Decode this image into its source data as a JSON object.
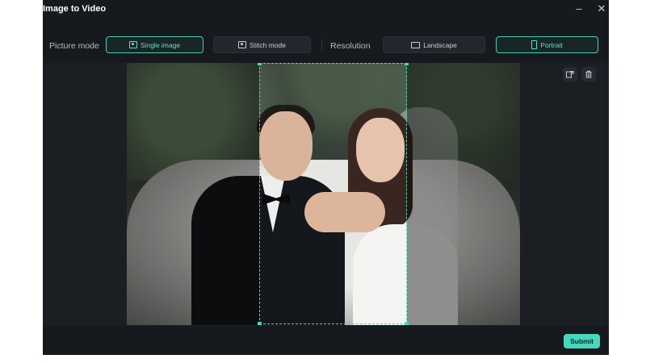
{
  "window": {
    "title": "Image to Video",
    "minimize_icon": "minimize-icon",
    "close_icon": "close-icon"
  },
  "toolbar": {
    "picture_mode_label": "Picture mode",
    "single_image_label": "Single image",
    "stitch_mode_label": "Stitch mode",
    "resolution_label": "Resolution",
    "landscape_label": "Landscape",
    "portrait_label": "Portrait",
    "selected_picture_mode": "Single image",
    "selected_resolution": "Portrait"
  },
  "canvas": {
    "replace_icon": "replace-image-icon",
    "delete_icon": "trash-icon"
  },
  "footer": {
    "submit_label": "Submit"
  },
  "colors": {
    "accent": "#45d8bd",
    "window_bg": "#16191d",
    "button_bg": "#23272d"
  }
}
